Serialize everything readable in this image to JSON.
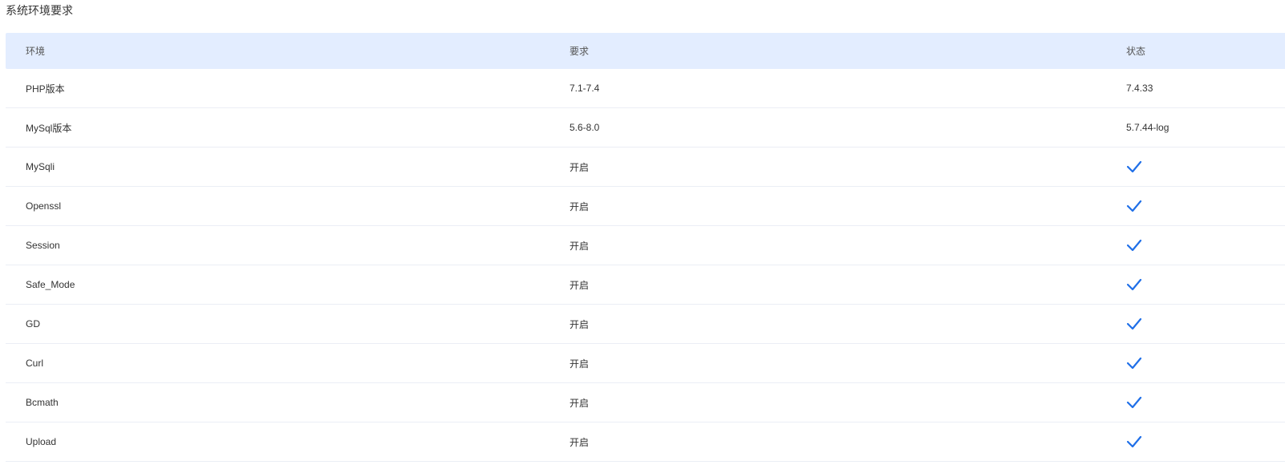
{
  "title": "系统环境要求",
  "table": {
    "headers": [
      "环境",
      "要求",
      "状态"
    ],
    "rows": [
      {
        "env": "PHP版本",
        "req": "7.1-7.4",
        "status": "7.4.33",
        "ok": false
      },
      {
        "env": "MySql版本",
        "req": "5.6-8.0",
        "status": "5.7.44-log",
        "ok": false
      },
      {
        "env": "MySqli",
        "req": "开启",
        "status": "",
        "ok": true
      },
      {
        "env": "Openssl",
        "req": "开启",
        "status": "",
        "ok": true
      },
      {
        "env": "Session",
        "req": "开启",
        "status": "",
        "ok": true
      },
      {
        "env": "Safe_Mode",
        "req": "开启",
        "status": "",
        "ok": true
      },
      {
        "env": "GD",
        "req": "开启",
        "status": "",
        "ok": true
      },
      {
        "env": "Curl",
        "req": "开启",
        "status": "",
        "ok": true
      },
      {
        "env": "Bcmath",
        "req": "开启",
        "status": "",
        "ok": true
      },
      {
        "env": "Upload",
        "req": "开启",
        "status": "",
        "ok": true
      }
    ]
  },
  "colors": {
    "accent": "#1f6fe8",
    "header_bg": "#e3edff",
    "divider": "#ebeef5"
  },
  "icons": {
    "status_ok": "check-icon"
  }
}
